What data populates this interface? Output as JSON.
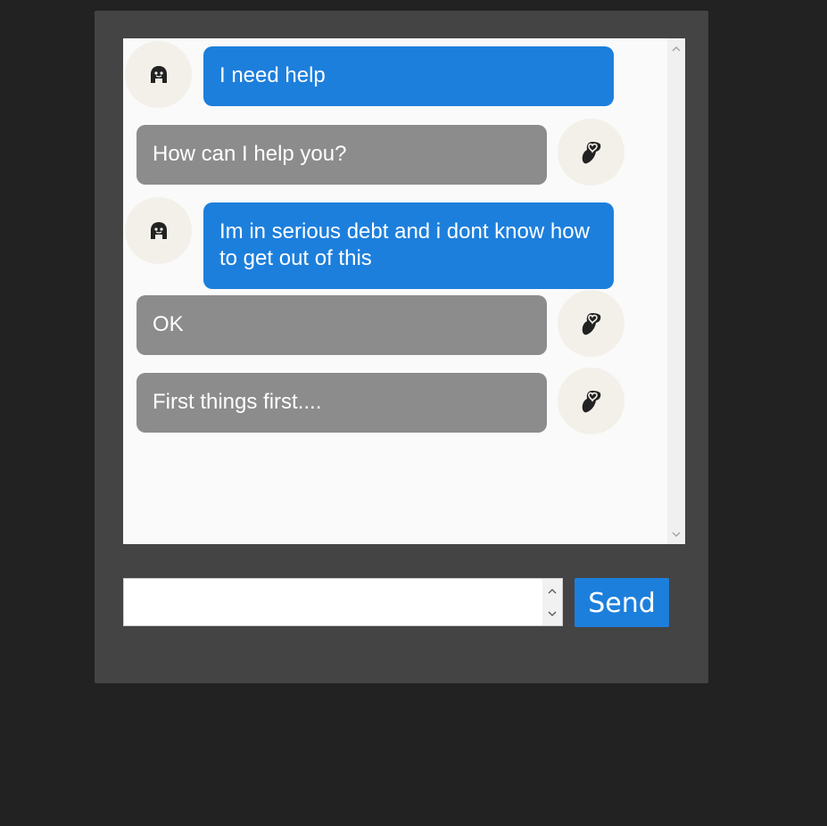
{
  "chat": {
    "messages": [
      {
        "role": "user",
        "text": "I need help"
      },
      {
        "role": "bot",
        "text": "How can I help you?"
      },
      {
        "role": "user",
        "text": "Im in serious debt and i dont know how to get out of this"
      },
      {
        "role": "bot",
        "text": "OK"
      },
      {
        "role": "bot",
        "text": "First things first...."
      }
    ]
  },
  "input": {
    "value": "",
    "placeholder": ""
  },
  "send_button": {
    "label": "Send"
  },
  "icons": {
    "user_avatar": "person-head-icon",
    "bot_avatar": "owl-bird-icon",
    "scroll_up": "chevron-up-icon",
    "scroll_down": "chevron-down-icon"
  },
  "colors": {
    "user_bubble": "#1d7fdc",
    "bot_bubble": "#8c8c8c",
    "send_button": "#1d7fdc",
    "panel": "#444444",
    "page_background": "#222222"
  }
}
